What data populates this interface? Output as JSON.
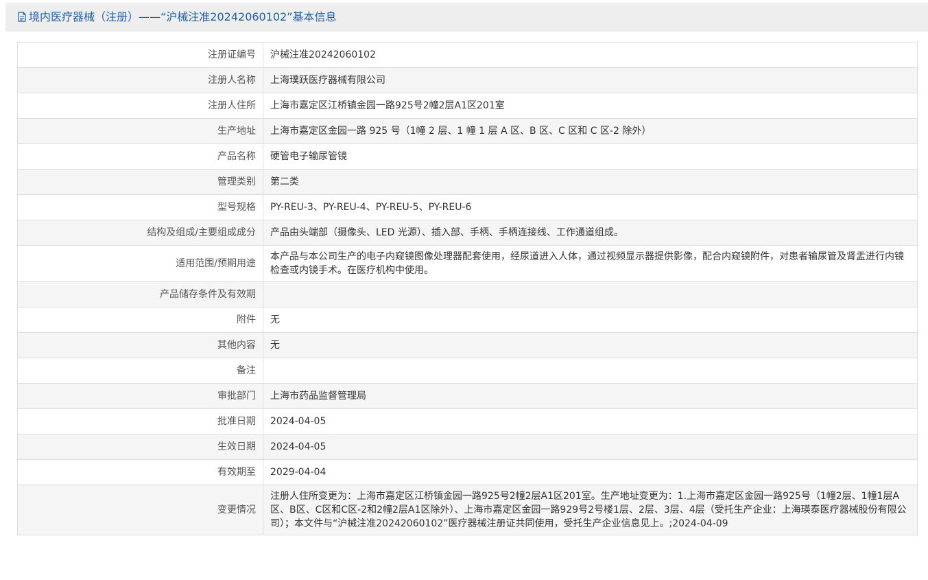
{
  "header": {
    "icon": "document-icon",
    "title": "境内医疗器械（注册）——“沪械注准20242060102”基本信息"
  },
  "rows": [
    {
      "label": "注册证编号",
      "value": "沪械注准20242060102"
    },
    {
      "label": "注册人名称",
      "value": "上海璞跃医疗器械有限公司"
    },
    {
      "label": "注册人住所",
      "value": "上海市嘉定区江桥镇金园一路925号2幢2层A1区201室"
    },
    {
      "label": "生产地址",
      "value": "上海市嘉定区金园一路 925 号（1幢 2 层、1 幢 1 层 A 区、B 区、C 区和 C 区-2 除外）"
    },
    {
      "label": "产品名称",
      "value": "硬管电子输尿管镜"
    },
    {
      "label": "管理类别",
      "value": "第二类"
    },
    {
      "label": "型号规格",
      "value": "PY-REU-3、PY-REU-4、PY-REU-5、PY-REU-6"
    },
    {
      "label": "结构及组成/主要组成成分",
      "value": "产品由头端部（摄像头、LED 光源）、插入部、手柄、手柄连接线、工作通道组成。"
    },
    {
      "label": "适用范围/预期用途",
      "value": "本产品与本公司生产的电子内窥镜图像处理器配套使用，经尿道进入人体，通过视频显示器提供影像，配合内窥镜附件，对患者输尿管及肾盂进行内镜检查或内镜手术。在医疗机构中使用。"
    },
    {
      "label": "产品储存条件及有效期",
      "value": ""
    },
    {
      "label": "附件",
      "value": "无"
    },
    {
      "label": "其他内容",
      "value": "无"
    },
    {
      "label": "备注",
      "value": ""
    },
    {
      "label": "审批部门",
      "value": "上海市药品监督管理局"
    },
    {
      "label": "批准日期",
      "value": "2024-04-05"
    },
    {
      "label": "生效日期",
      "value": "2024-04-05"
    },
    {
      "label": "有效期至",
      "value": "2029-04-04"
    },
    {
      "label": "变更情况",
      "value": "注册人住所变更为：上海市嘉定区江桥镇金园一路925号2幢2层A1区201室。生产地址变更为：1.上海市嘉定区金园一路925号（1幢2层、1幢1层A区、B区、C区和C区-2和2幢2层A1区除外）、上海市嘉定区金园一路929号2号楼1层、2层、3层、4层（受托生产企业：上海瑛泰医疗器械股份有限公司）；本文件与“沪械注准20242060102”医疗器械注册证共同使用，受托生产企业信息见上。;2024-04-09"
    }
  ]
}
